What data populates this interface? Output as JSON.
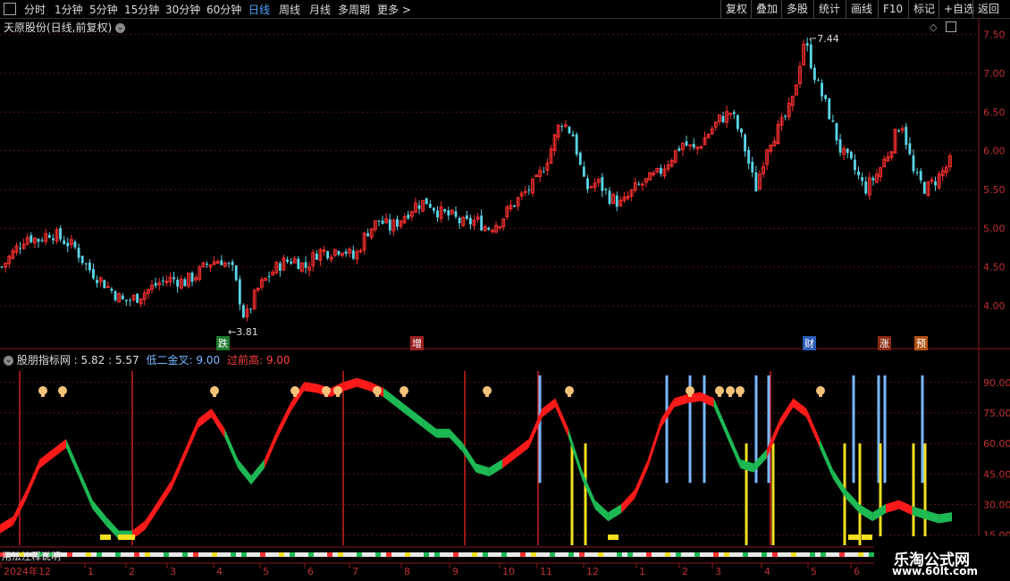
{
  "toolbar": {
    "periods": [
      "分时",
      "1分钟",
      "5分钟",
      "15分钟",
      "30分钟",
      "60分钟",
      "日线",
      "周线",
      "月线",
      "多周期",
      "更多 >"
    ],
    "active_period": "日线",
    "right_buttons": [
      "复权",
      "叠加",
      "多股",
      "统计",
      "画线",
      "F10",
      "标记",
      "+自选",
      "返回"
    ]
  },
  "main_title": "天原股份(日线,前复权)",
  "price_axis": [
    "7.50",
    "7.00",
    "6.50",
    "6.00",
    "5.50",
    "5.00",
    "4.50",
    "4.00"
  ],
  "annotations": {
    "high": "7.44",
    "low": "3.81"
  },
  "event_labels": [
    {
      "text": "跌",
      "color": "#2a9a3a"
    },
    {
      "text": "增",
      "color": "#c0392b"
    },
    {
      "text": "财",
      "color": "#2e6bd0"
    },
    {
      "text": "涨",
      "color": "#b03a1a"
    },
    {
      "text": "预",
      "color": "#c0661a"
    }
  ],
  "indicator": {
    "name": "股朋指标网",
    "v1": "5.82",
    "v2": "5.57",
    "signal1_label": "低二金叉:",
    "signal1_value": "9.00",
    "signal2_label": "过前高:",
    "signal2_value": "9.00",
    "axis": [
      "90.00",
      "75.00",
      "60.00",
      "45.00",
      "30.00",
      "15.00"
    ]
  },
  "footer": {
    "label": "用法注释说明"
  },
  "date_axis": [
    "2024年12",
    "1",
    "2",
    "3",
    "4",
    "5",
    "6",
    "7",
    "8",
    "9",
    "10",
    "11",
    "12",
    "1",
    "2",
    "3",
    "4",
    "5",
    "6"
  ],
  "watermark": {
    "line1": "乐淘公式网",
    "line2": "www.60lt.com"
  },
  "chart_data": {
    "type": "candlestick",
    "title": "天原股份(日线,前复权)",
    "ylim": [
      3.7,
      7.6
    ],
    "close_series": [
      4.5,
      4.7,
      4.9,
      4.85,
      4.95,
      4.85,
      4.75,
      4.5,
      4.35,
      4.2,
      4.05,
      4.1,
      4.2,
      4.3,
      4.35,
      4.3,
      4.4,
      4.55,
      4.6,
      4.45,
      3.81,
      4.2,
      4.4,
      4.55,
      4.6,
      4.5,
      4.7,
      4.7,
      4.75,
      4.6,
      4.95,
      5.1,
      5.0,
      5.15,
      5.3,
      5.35,
      5.2,
      5.15,
      5.05,
      5.1,
      5.0,
      5.1,
      5.3,
      5.45,
      5.6,
      5.95,
      6.4,
      6.2,
      5.5,
      5.6,
      5.4,
      5.3,
      5.5,
      5.6,
      5.7,
      5.9,
      6.1,
      6.0,
      6.2,
      6.4,
      6.5,
      6.1,
      5.5,
      6.1,
      6.3,
      6.6,
      7.44,
      6.9,
      6.5,
      6.0,
      5.8,
      5.5,
      5.7,
      6.0,
      6.4,
      5.7,
      5.5,
      5.65,
      5.85
    ]
  },
  "indicator_data": {
    "ylim": [
      10,
      100
    ],
    "curve": [
      18,
      22,
      35,
      50,
      55,
      60,
      45,
      30,
      22,
      15,
      15,
      20,
      30,
      40,
      55,
      70,
      75,
      65,
      50,
      42,
      50,
      65,
      78,
      88,
      87,
      85,
      88,
      90,
      88,
      85,
      80,
      75,
      70,
      65,
      65,
      58,
      48,
      46,
      50,
      55,
      60,
      75,
      80,
      65,
      45,
      30,
      24,
      28,
      35,
      50,
      70,
      80,
      82,
      83,
      80,
      65,
      50,
      48,
      55,
      70,
      80,
      75,
      60,
      45,
      35,
      28,
      24,
      28,
      30,
      27,
      25,
      23,
      24
    ],
    "rising": [
      1,
      1,
      1,
      1,
      1,
      0,
      0,
      0,
      0,
      0,
      1,
      1,
      1,
      1,
      1,
      1,
      1,
      0,
      0,
      0,
      1,
      1,
      1,
      1,
      1,
      1,
      1,
      1,
      1,
      0,
      0,
      0,
      0,
      0,
      0,
      0,
      0,
      0,
      1,
      1,
      1,
      1,
      1,
      0,
      0,
      0,
      0,
      1,
      1,
      1,
      1,
      1,
      1,
      1,
      0,
      0,
      0,
      0,
      1,
      1,
      1,
      1,
      0,
      0,
      0,
      0,
      0,
      1,
      1,
      0,
      0,
      0,
      1
    ]
  }
}
